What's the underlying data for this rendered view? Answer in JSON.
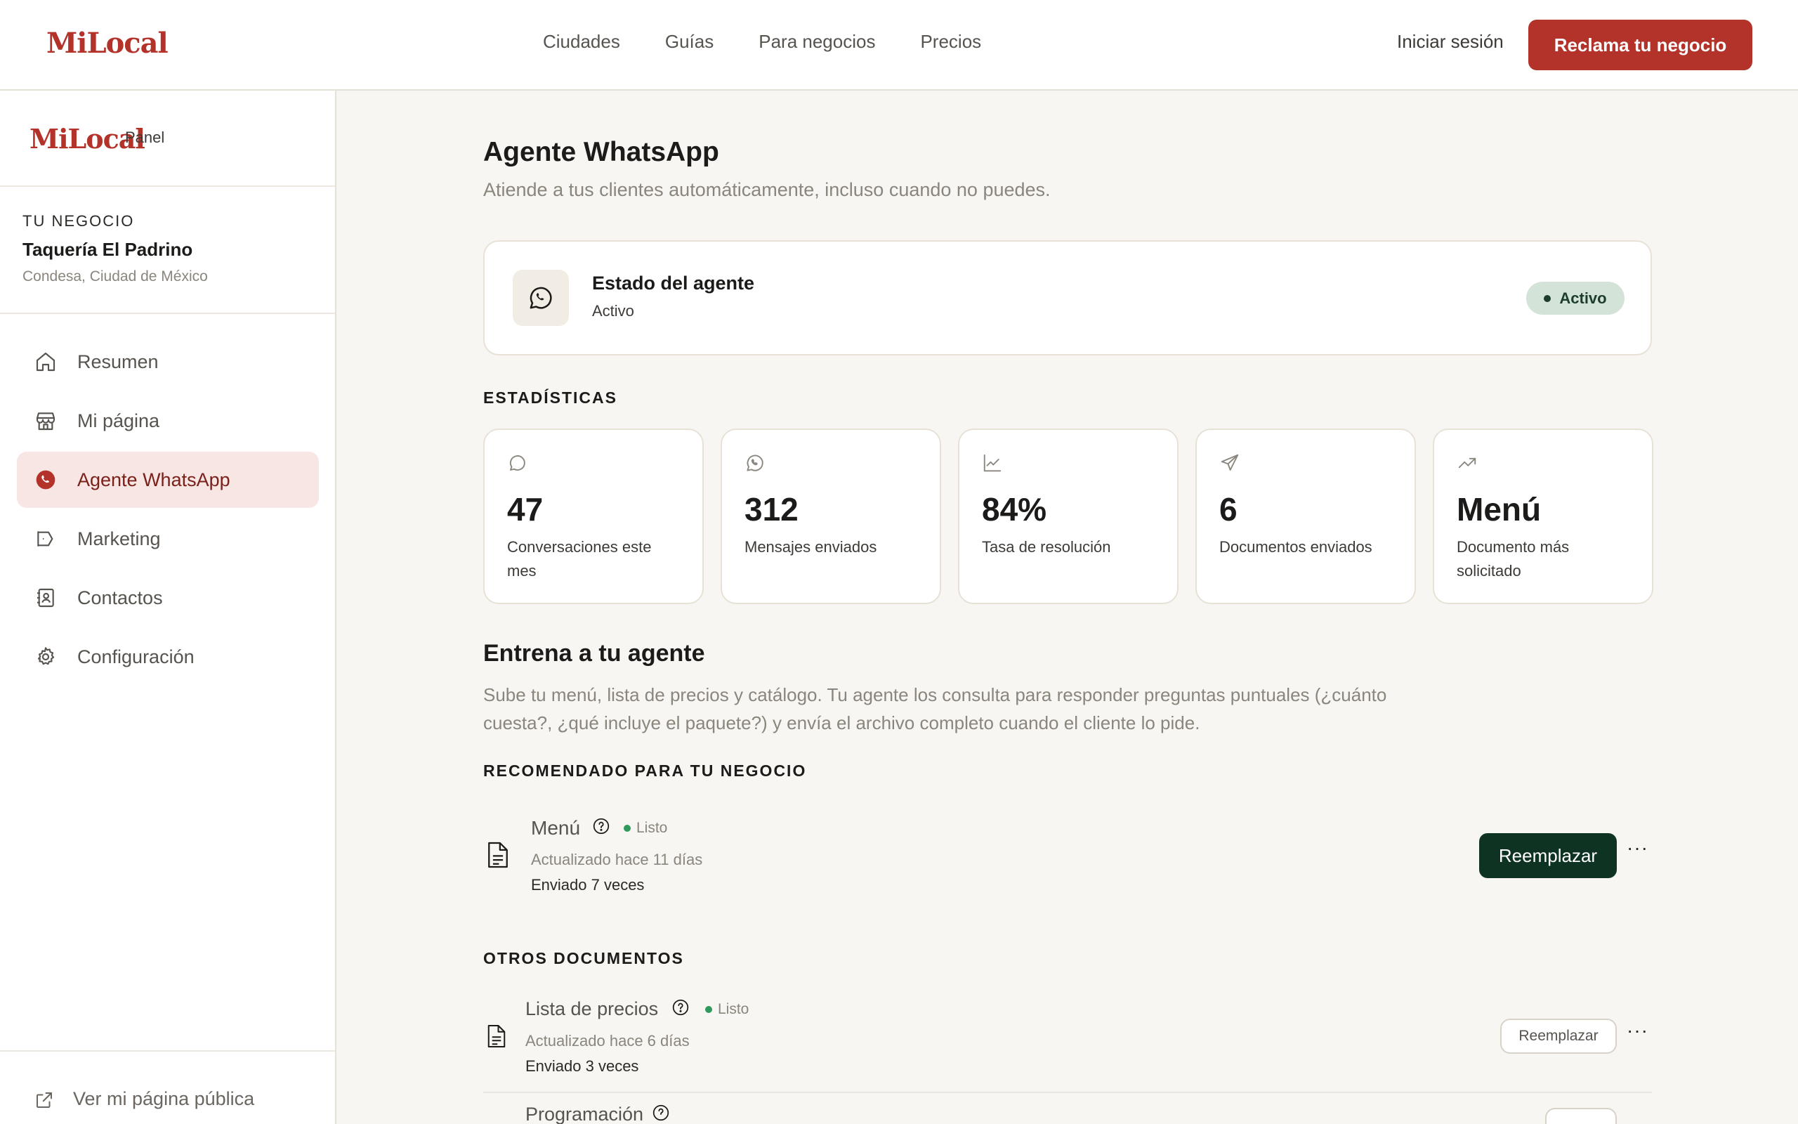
{
  "topbar": {
    "logo": "MiLocal",
    "nav": [
      "Ciudades",
      "Guías",
      "Para negocios",
      "Precios"
    ],
    "login": "Iniciar sesión",
    "cta": "Reclama tu negocio"
  },
  "sidebar": {
    "logo": "MiLocal",
    "panel": "Panel",
    "business_kicker": "TU NEGOCIO",
    "business_name": "Taquería El Padrino",
    "business_location": "Condesa, Ciudad de México",
    "items": [
      {
        "label": "Resumen",
        "icon": "home-icon"
      },
      {
        "label": "Mi página",
        "icon": "store-icon"
      },
      {
        "label": "Agente WhatsApp",
        "icon": "whatsapp-icon",
        "active": true
      },
      {
        "label": "Marketing",
        "icon": "megaphone-icon"
      },
      {
        "label": "Contactos",
        "icon": "contacts-icon"
      },
      {
        "label": "Configuración",
        "icon": "gear-icon"
      }
    ],
    "footer_link": "Ver mi página pública"
  },
  "main": {
    "title": "Agente WhatsApp",
    "subtitle": "Atiende a tus clientes automáticamente, incluso cuando no puedes.",
    "status": {
      "title": "Estado del agente",
      "value": "Activo",
      "badge": "Activo"
    },
    "stats_label": "ESTADÍSTICAS",
    "stats": [
      {
        "value": "47",
        "label": "Conversaciones este mes",
        "icon": "chat-bubble-icon"
      },
      {
        "value": "312",
        "label": "Mensajes enviados",
        "icon": "whatsapp-icon"
      },
      {
        "value": "84%",
        "label": "Tasa de resolución",
        "icon": "line-chart-icon"
      },
      {
        "value": "6",
        "label": "Documentos enviados",
        "icon": "send-icon"
      },
      {
        "value": "Menú",
        "label": "Documento más solicitado",
        "icon": "trending-up-icon"
      }
    ],
    "train_title": "Entrena a tu agente",
    "train_desc": "Sube tu menú, lista de precios y catálogo. Tu agente los consulta para responder preguntas puntuales (¿cuánto cuesta?, ¿qué incluye el paquete?) y envía el archivo completo cuando el cliente lo pide.",
    "recommended_label": "RECOMENDADO PARA TU NEGOCIO",
    "recommended_doc": {
      "name": "Menú",
      "status": "Listo",
      "updated": "Actualizado hace 11 días",
      "sent": "Enviado 7 veces",
      "action": "Reemplazar"
    },
    "other_label": "OTROS DOCUMENTOS",
    "other_docs": [
      {
        "name": "Lista de precios",
        "status": "Listo",
        "updated": "Actualizado hace 6 días",
        "sent": "Enviado 3 veces",
        "action": "Reemplazar"
      },
      {
        "name": "Programación"
      }
    ],
    "more_glyph": "···",
    "colors": {
      "brand": "#b3332b",
      "success": "#2f9a5a",
      "primary_dark": "#0e3322",
      "background": "#f8f6f2"
    }
  }
}
